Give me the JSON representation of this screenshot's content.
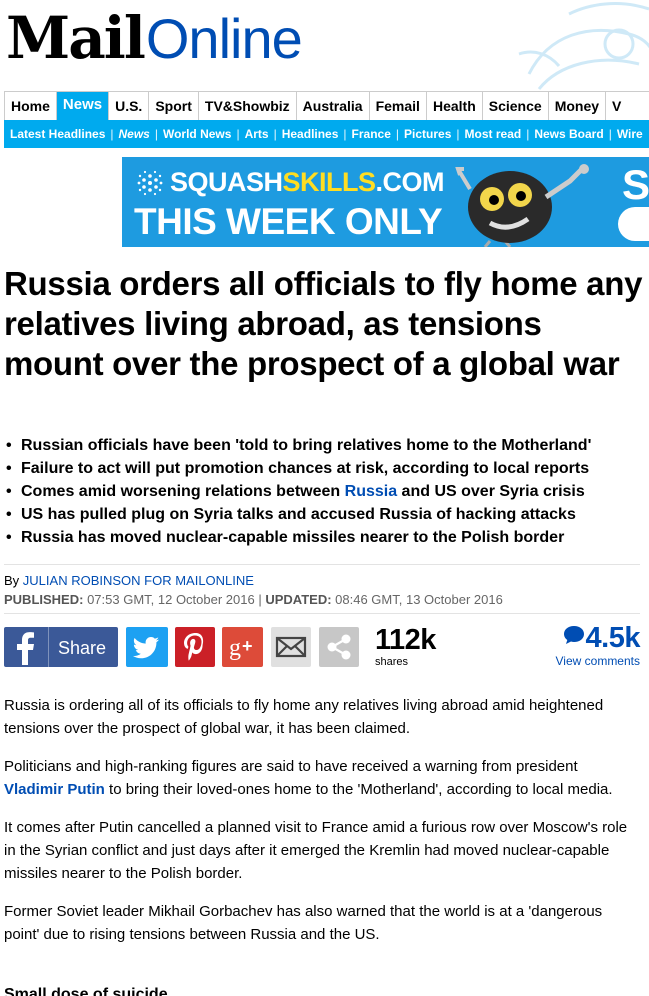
{
  "masthead": {
    "logo_mail": "Mail",
    "logo_online": "Online"
  },
  "nav_primary": {
    "items": [
      "Home",
      "News",
      "U.S.",
      "Sport",
      "TV&Showbiz",
      "Australia",
      "Femail",
      "Health",
      "Science",
      "Money",
      "V"
    ],
    "active": "News"
  },
  "nav_secondary": {
    "items": [
      "Latest Headlines",
      "News",
      "World News",
      "Arts",
      "Headlines",
      "France",
      "Pictures",
      "Most read",
      "News Board",
      "Wire"
    ]
  },
  "ad": {
    "brand_part1": "SQUASH",
    "brand_part2": "SKILLS",
    "brand_part3": ".COM",
    "headline": "THIS WEEK ONLY",
    "cut_letter": "S"
  },
  "article": {
    "headline": "Russia orders all officials to fly home any relatives living abroad, as tensions mount over the prospect of a global war",
    "bullets": [
      {
        "text": "Russian officials have been 'told to bring relatives home to the Motherland'"
      },
      {
        "text": "Failure to act will put promotion chances at risk, according to local reports"
      },
      {
        "before": "Comes amid worsening relations between ",
        "link": "Russia",
        "after": " and US over Syria crisis"
      },
      {
        "text": "US has pulled plug on Syria talks and accused Russia of hacking attacks"
      },
      {
        "text": "Russia has moved nuclear-capable missiles nearer to the Polish border"
      }
    ],
    "byline_prefix": "By ",
    "byline_author": "JULIAN ROBINSON FOR MAILONLINE",
    "published_label": "PUBLISHED:",
    "published_value": " 07:53 GMT, 12 October 2016 ",
    "separator": "|",
    "updated_label": " UPDATED:",
    "updated_value": " 08:46 GMT, 13 October 2016",
    "paragraphs": [
      {
        "text": "Russia is ordering all of its officials to fly home any relatives living abroad amid heightened tensions over the prospect of global war, it has been claimed."
      },
      {
        "before": "Politicians and high-ranking figures are said to have received a warning from president ",
        "link": "Vladimir Putin",
        "after": " to bring their loved-ones home to the 'Motherland', according to local media."
      },
      {
        "text": "It comes after Putin cancelled a planned visit to France amid a furious row over Moscow's role in the Syrian conflict and just days after it emerged the Kremlin had moved nuclear-capable missiles nearer to the Polish border."
      },
      {
        "text": "Former Soviet leader Mikhail Gorbachev has also warned that the world is at a 'dangerous point' due to rising tensions between Russia and the US."
      }
    ],
    "subheading": "Small dose of suicide"
  },
  "share": {
    "facebook_label": "Share",
    "share_count": "112k",
    "share_label": "shares",
    "comment_count": "4.5k",
    "comment_label": "View comments",
    "icons": [
      "facebook-icon",
      "twitter-icon",
      "pinterest-icon",
      "google-plus-icon",
      "email-icon",
      "share-icon",
      "comment-bubble-icon"
    ]
  },
  "colors": {
    "brand_blue": "#004db3",
    "nav_cyan": "#00aaee",
    "facebook": "#3b5998",
    "twitter": "#1da1f2",
    "pinterest": "#cb2027",
    "google_plus": "#dd4b39",
    "ad_blue": "#1e9be0",
    "ad_yellow": "#ffdd22"
  }
}
